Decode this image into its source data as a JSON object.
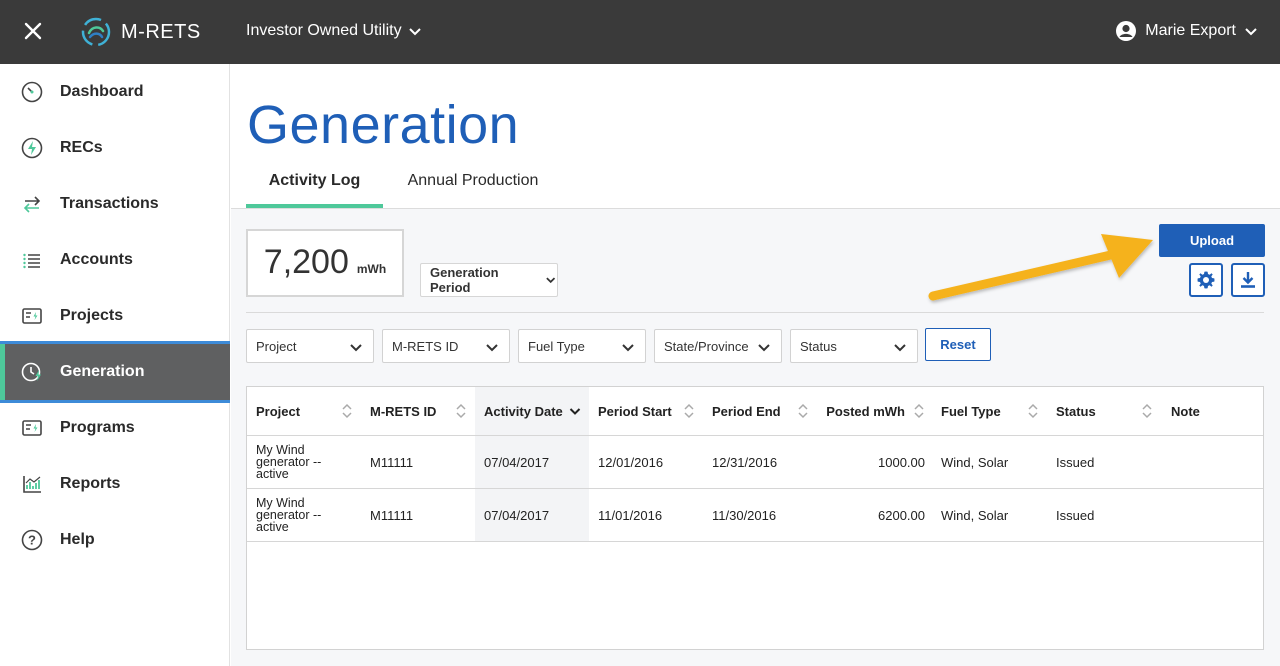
{
  "topbar": {
    "brand": "M-RETS",
    "org": "Investor Owned Utility",
    "user": "Marie Export"
  },
  "sidebar": {
    "items": [
      {
        "label": "Dashboard",
        "icon": "gauge-icon"
      },
      {
        "label": "RECs",
        "icon": "bolt-circle-icon"
      },
      {
        "label": "Transactions",
        "icon": "transfer-arrows-icon"
      },
      {
        "label": "Accounts",
        "icon": "list-icon"
      },
      {
        "label": "Projects",
        "icon": "project-card-icon"
      },
      {
        "label": "Generation",
        "icon": "clock-bolt-icon",
        "active": true
      },
      {
        "label": "Programs",
        "icon": "program-card-icon"
      },
      {
        "label": "Reports",
        "icon": "chart-icon"
      },
      {
        "label": "Help",
        "icon": "question-circle-icon"
      }
    ]
  },
  "main": {
    "title": "Generation",
    "tabs": [
      {
        "label": "Activity Log",
        "active": true
      },
      {
        "label": "Annual Production",
        "active": false
      }
    ],
    "total": {
      "value": "7,200",
      "unit": "mWh"
    },
    "period_select": "Generation Period",
    "upload_label": "Upload",
    "filters": [
      "Project",
      "M-RETS ID",
      "Fuel Type",
      "State/Province",
      "Status"
    ],
    "reset_label": "Reset",
    "colors": {
      "accent": "#1f5fb7",
      "tab_underline": "#4ec89a",
      "arrow": "#f5b21b"
    }
  },
  "table": {
    "headers": [
      "Project",
      "M-RETS ID",
      "Activity Date",
      "Period Start",
      "Period End",
      "Posted mWh",
      "Fuel Type",
      "Status",
      "Note"
    ],
    "rows": [
      {
        "project_l1": "My Wind",
        "project_l2": "generator --",
        "project_l3": "active",
        "mrets_id": "M11111",
        "activity_date": "07/04/2017",
        "period_start": "12/01/2016",
        "period_end": "12/31/2016",
        "posted": "1000.00",
        "fuel": "Wind, Solar",
        "status": "Issued",
        "note": ""
      },
      {
        "project_l1": "My Wind",
        "project_l2": "generator --",
        "project_l3": "active",
        "mrets_id": "M11111",
        "activity_date": "07/04/2017",
        "period_start": "11/01/2016",
        "period_end": "11/30/2016",
        "posted": "6200.00",
        "fuel": "Wind, Solar",
        "status": "Issued",
        "note": ""
      }
    ]
  }
}
